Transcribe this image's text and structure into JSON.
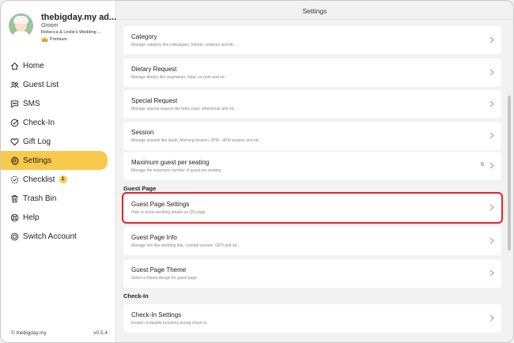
{
  "profile": {
    "name": "thebigday.my ad...",
    "role": "Groom",
    "event": "Rebecca & Leslie's Wedding ...",
    "plan": "Premium"
  },
  "nav": {
    "items": [
      {
        "label": "Home",
        "icon": "home-icon"
      },
      {
        "label": "Guest List",
        "icon": "guests-icon"
      },
      {
        "label": "SMS",
        "icon": "sms-icon"
      },
      {
        "label": "Check-In",
        "icon": "check-in-icon"
      },
      {
        "label": "Gift Log",
        "icon": "heart-icon"
      },
      {
        "label": "Settings",
        "icon": "gear-icon",
        "active": true
      },
      {
        "label": "Checklist",
        "icon": "checklist-icon",
        "badge": "1"
      },
      {
        "label": "Trash Bin",
        "icon": "trash-icon"
      },
      {
        "label": "Help",
        "icon": "help-icon"
      },
      {
        "label": "Switch Account",
        "icon": "switch-icon"
      }
    ]
  },
  "footer": {
    "copyright": "© thebigday.my",
    "version": "v0.5.4"
  },
  "main": {
    "title": "Settings",
    "cards": [
      {
        "title": "Category",
        "desc": "Manage category like colleagues, friends, relatives and etc."
      },
      {
        "title": "Dietary Request",
        "desc": "Manage dietary like vegetarian, halal, no pork and etc."
      },
      {
        "title": "Special Request",
        "desc": "Manage special request like baby chair, wheelchair and etc."
      },
      {
        "title": "Session",
        "desc": "Manage session like lakah, Morning session, 2PM - 4PM session and etc."
      },
      {
        "title": "Maximum guest per seating",
        "desc": "Manage the maximum number of guest per seating.",
        "value": "6"
      }
    ],
    "guest_page_label": "Guest Page",
    "guest_page_cards": [
      {
        "title": "Guest Page Settings",
        "desc": "Hide or show wedding details on QR page."
      },
      {
        "title": "Guest Page Info",
        "desc": "Manage info like wedding title, cocktail session, GPS and etc."
      },
      {
        "title": "Guest Page Theme",
        "desc": "Select a theme design for guest page."
      }
    ],
    "check_in_label": "Check-In",
    "check_in_cards": [
      {
        "title": "Check-In Settings",
        "desc": "Enable or disable functions during check-in."
      }
    ]
  },
  "colors": {
    "accent": "#f9c94b",
    "highlight_border": "#e8202a",
    "background": "#f2f2f2"
  }
}
